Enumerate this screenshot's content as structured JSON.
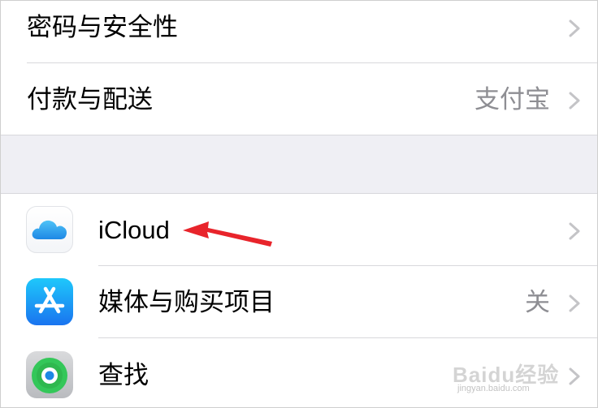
{
  "settings": {
    "group1": [
      {
        "label": "密码与安全性",
        "value": ""
      },
      {
        "label": "付款与配送",
        "value": "支付宝"
      }
    ],
    "group2": [
      {
        "label": "iCloud",
        "value": "",
        "icon": "icloud-icon"
      },
      {
        "label": "媒体与购买项目",
        "value": "关",
        "icon": "app-store-icon"
      },
      {
        "label": "查找",
        "value": "",
        "icon": "find-my-icon"
      }
    ]
  },
  "annotation": {
    "arrow_color": "#e8242b",
    "target": "iCloud"
  },
  "watermark": {
    "brand": "Baidu经验",
    "url": "jingyan.baidu.com"
  },
  "colors": {
    "separator": "#d8d8dc",
    "group_gap": "#efeff4",
    "secondary_text": "#8e8e93",
    "chevron": "#c4c4c7"
  }
}
